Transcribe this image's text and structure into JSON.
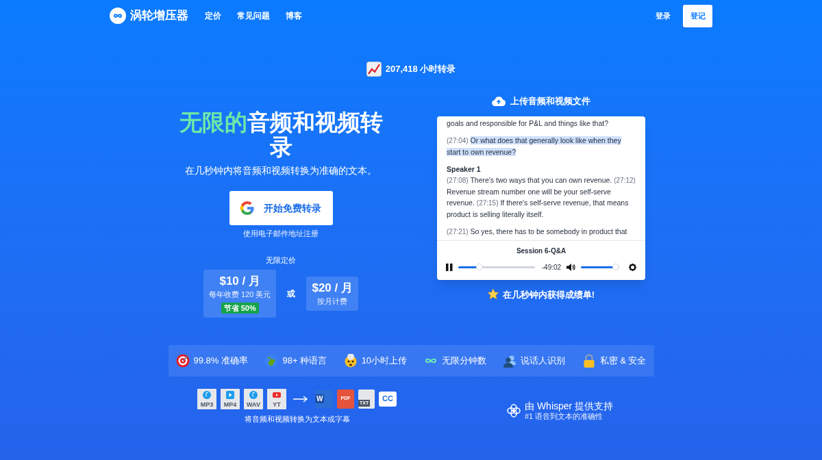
{
  "nav": {
    "logo_text": "涡轮增压器",
    "links": [
      "定价",
      "常见问题",
      "博客"
    ],
    "login": "登录",
    "signup": "登记"
  },
  "stat": {
    "text": "207,418 小时转录"
  },
  "hero": {
    "title_highlight": "无限的",
    "title_rest": "音频和视频转录",
    "subtitle": "在几秒钟内将音频和视频转换为准确的文本。",
    "cta": "开始免费转录",
    "cta_note": "使用电子邮件地址注册",
    "pricing_label": "无限定价",
    "or_text": "或",
    "plans": [
      {
        "price": "$10 / 月",
        "note": "每年收费 120 美元",
        "badge": "节省 50%"
      },
      {
        "price": "$20 / 月",
        "note": "按月计费"
      }
    ]
  },
  "player": {
    "upload_label": "上传音频和视频文件",
    "transcript": [
      {
        "segments": [
          {
            "text": "goals and responsible for P&L and things like that?",
            "highlighted": false
          }
        ]
      },
      {
        "segments": [
          {
            "time": "(27:04)",
            "text": "Or what does that generally look like when they start to own revenue?",
            "highlighted": true
          }
        ]
      },
      {
        "speaker": "Speaker 1",
        "segments": [
          {
            "time": "(27:08)",
            "text": "There's two ways that you can own revenue.",
            "highlighted": false
          },
          {
            "time": "(27:12)",
            "text": "Revenue stream number one will be your self-serve revenue.",
            "highlighted": false
          },
          {
            "time": "(27:15)",
            "text": "If there's self-serve revenue, that means product is selling literally itself.",
            "highlighted": false
          }
        ]
      },
      {
        "segments": [
          {
            "time": "(27:21)",
            "text": "So yes, there has to be somebody in product that",
            "highlighted": false
          }
        ]
      }
    ],
    "session_title": "Session 6-Q&A",
    "playing": true,
    "progress": {
      "level": 0.26
    },
    "time": "-49:02",
    "volume": {
      "level": 1.0
    },
    "tagline": "在几秒钟内获得成绩单!"
  },
  "features": [
    {
      "kind": "target",
      "text": "99.8% 准确率"
    },
    {
      "kind": "globe",
      "text": "98+ 种语言"
    },
    {
      "kind": "mind-blown",
      "text": "10小时上传"
    },
    {
      "kind": "infinity",
      "text": "无限分钟数"
    },
    {
      "kind": "users",
      "text": "说话人识别"
    },
    {
      "kind": "lock",
      "text": "私密 & 安全"
    }
  ],
  "formats": {
    "inputs": [
      {
        "kind": "audio",
        "label": "MP3"
      },
      {
        "kind": "video",
        "label": "MP4"
      },
      {
        "kind": "audio",
        "label": "WAV"
      },
      {
        "kind": "youtube",
        "label": "YT"
      }
    ],
    "outputs": [
      {
        "kind": "word",
        "label": "W"
      },
      {
        "kind": "pdf",
        "label": "PDF"
      },
      {
        "kind": "txt",
        "label": "TXT"
      },
      {
        "kind": "cc",
        "label": "CC"
      }
    ],
    "caption": "将音频和视频转换为文本或字幕"
  },
  "whisper": {
    "title": "由 Whisper 提供支持",
    "subtitle": "#1 语音到文本的准确性"
  }
}
